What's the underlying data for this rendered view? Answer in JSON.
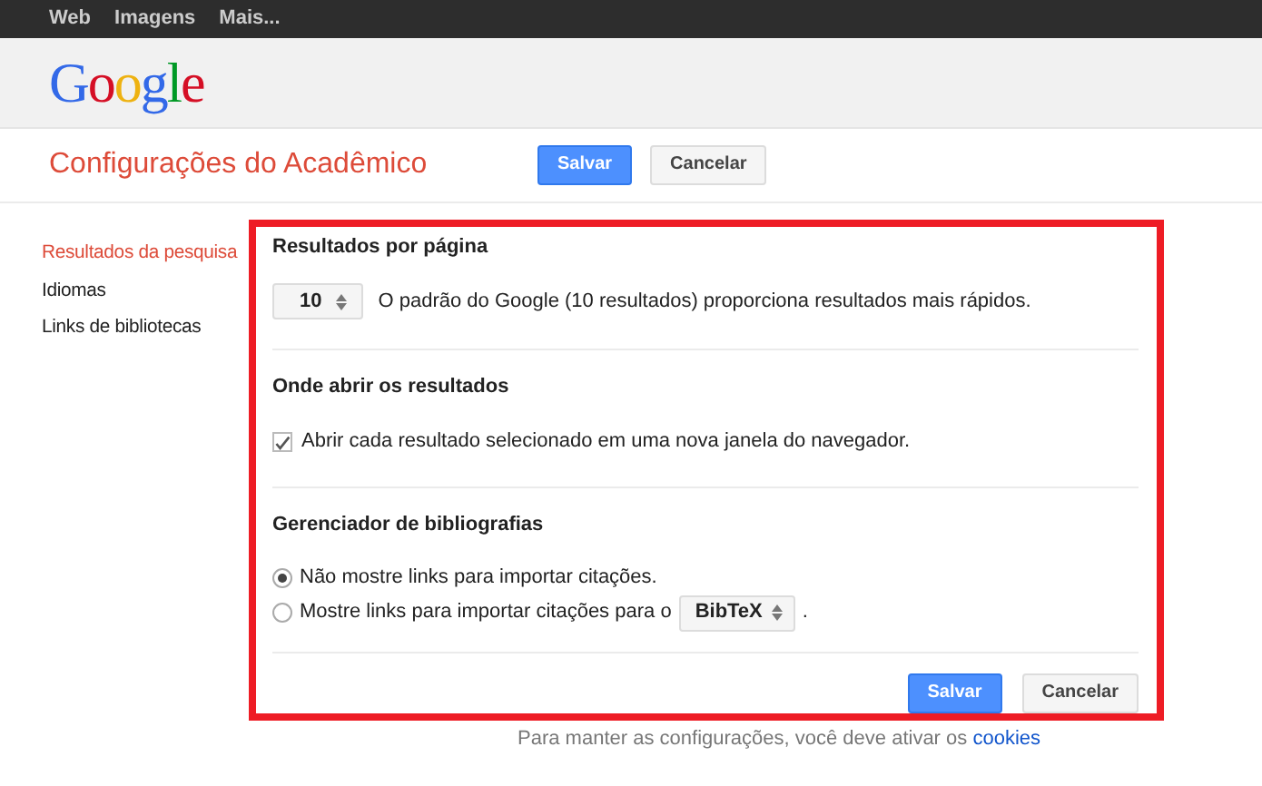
{
  "top_bar": {
    "links": [
      "Web",
      "Imagens",
      "Mais..."
    ]
  },
  "header": {
    "logo": "Google"
  },
  "title_bar": {
    "title": "Configurações do Acadêmico",
    "buttons": [
      {
        "label": "Salvar",
        "kind": "primary"
      },
      {
        "label": "Cancelar",
        "kind": "secondary"
      }
    ]
  },
  "sidebar": {
    "items": [
      {
        "label": "Resultados da pesquisa",
        "selected": true
      },
      {
        "label": "Idiomas",
        "selected": false
      },
      {
        "label": "Links de bibliotecas",
        "selected": false
      }
    ]
  },
  "sections": [
    {
      "kind": "select",
      "heading": "Resultados por página",
      "select": {
        "value": "10"
      },
      "text": "O padrão do Google (10 resultados) proporciona resultados mais rápidos."
    },
    {
      "kind": "checkbox",
      "heading": "Onde abrir os resultados",
      "label": "Abrir cada resultado selecionado em uma nova janela do navegador.",
      "checked": true
    },
    {
      "kind": "radio",
      "heading": "Gerenciador de bibliografias",
      "options": [
        {
          "label": "Não mostre links para importar citações.",
          "selected": true
        },
        {
          "label": "Mostre links para importar citações para o",
          "selected": false,
          "select": {
            "value": "BibTeX"
          },
          "after": "."
        }
      ]
    }
  ],
  "form_buttons": [
    {
      "label": "Salvar",
      "kind": "primary"
    },
    {
      "label": "Cancelar",
      "kind": "secondary"
    }
  ],
  "footer": {
    "text": "Para manter as configurações, você deve ativar os",
    "link": "cookies"
  }
}
